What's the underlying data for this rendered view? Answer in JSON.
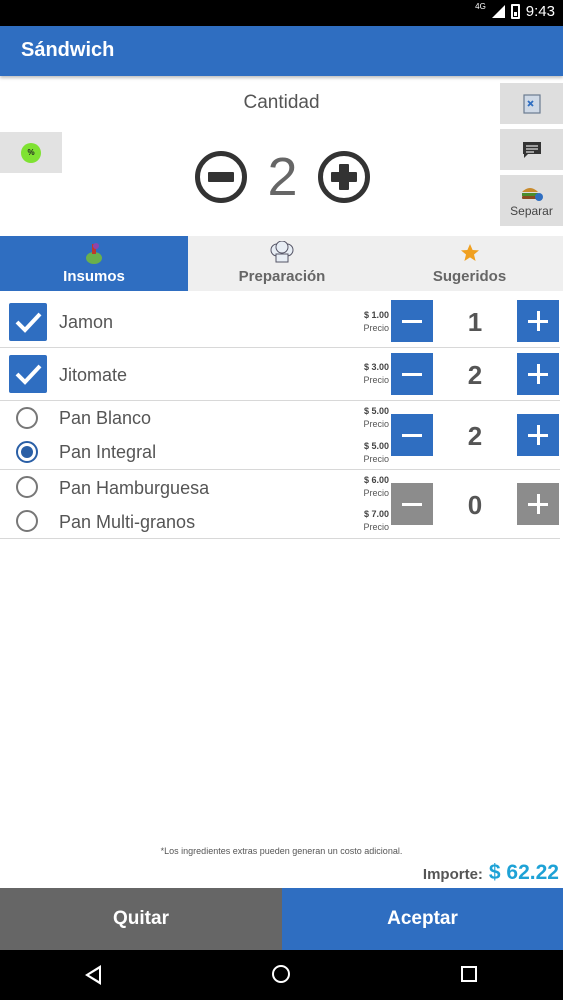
{
  "status_bar": {
    "network": "4G",
    "time": "9:43"
  },
  "app_bar": {
    "title": "Sándwich"
  },
  "quantity": {
    "label": "Cantidad",
    "value": "2"
  },
  "side_actions": {
    "discount_icon_text": "%",
    "separar_label": "Separar"
  },
  "tabs": [
    {
      "label": "Insumos",
      "active": true
    },
    {
      "label": "Preparación",
      "active": false
    },
    {
      "label": "Sugeridos",
      "active": false
    }
  ],
  "ingredients": {
    "price_label": "Precio",
    "rows": [
      {
        "type": "checkbox",
        "name": "Jamon",
        "price": "$ 1.00",
        "checked": true,
        "qty": "1"
      },
      {
        "type": "checkbox",
        "name": "Jitomate",
        "price": "$ 3.00",
        "checked": true,
        "qty": "2"
      }
    ],
    "groups": [
      {
        "qty": "2",
        "enabled": true,
        "options": [
          {
            "name": "Pan Blanco",
            "price": "$ 5.00",
            "selected": false
          },
          {
            "name": "Pan Integral",
            "price": "$ 5.00",
            "selected": true
          }
        ]
      },
      {
        "qty": "0",
        "enabled": false,
        "options": [
          {
            "name": "Pan Hamburguesa",
            "price": "$ 6.00",
            "selected": false
          },
          {
            "name": "Pan Multi-granos",
            "price": "$ 7.00",
            "selected": false
          }
        ]
      }
    ]
  },
  "footer": {
    "note": "*Los ingredientes extras pueden generan un costo adicional.",
    "importe_label": "Importe:",
    "importe_value": "$ 62.22"
  },
  "actions": {
    "quitar": "Quitar",
    "aceptar": "Aceptar"
  },
  "colors": {
    "primary": "#2f6ec1",
    "amount": "#1ea2d6",
    "disabled": "#8c8c8c"
  }
}
